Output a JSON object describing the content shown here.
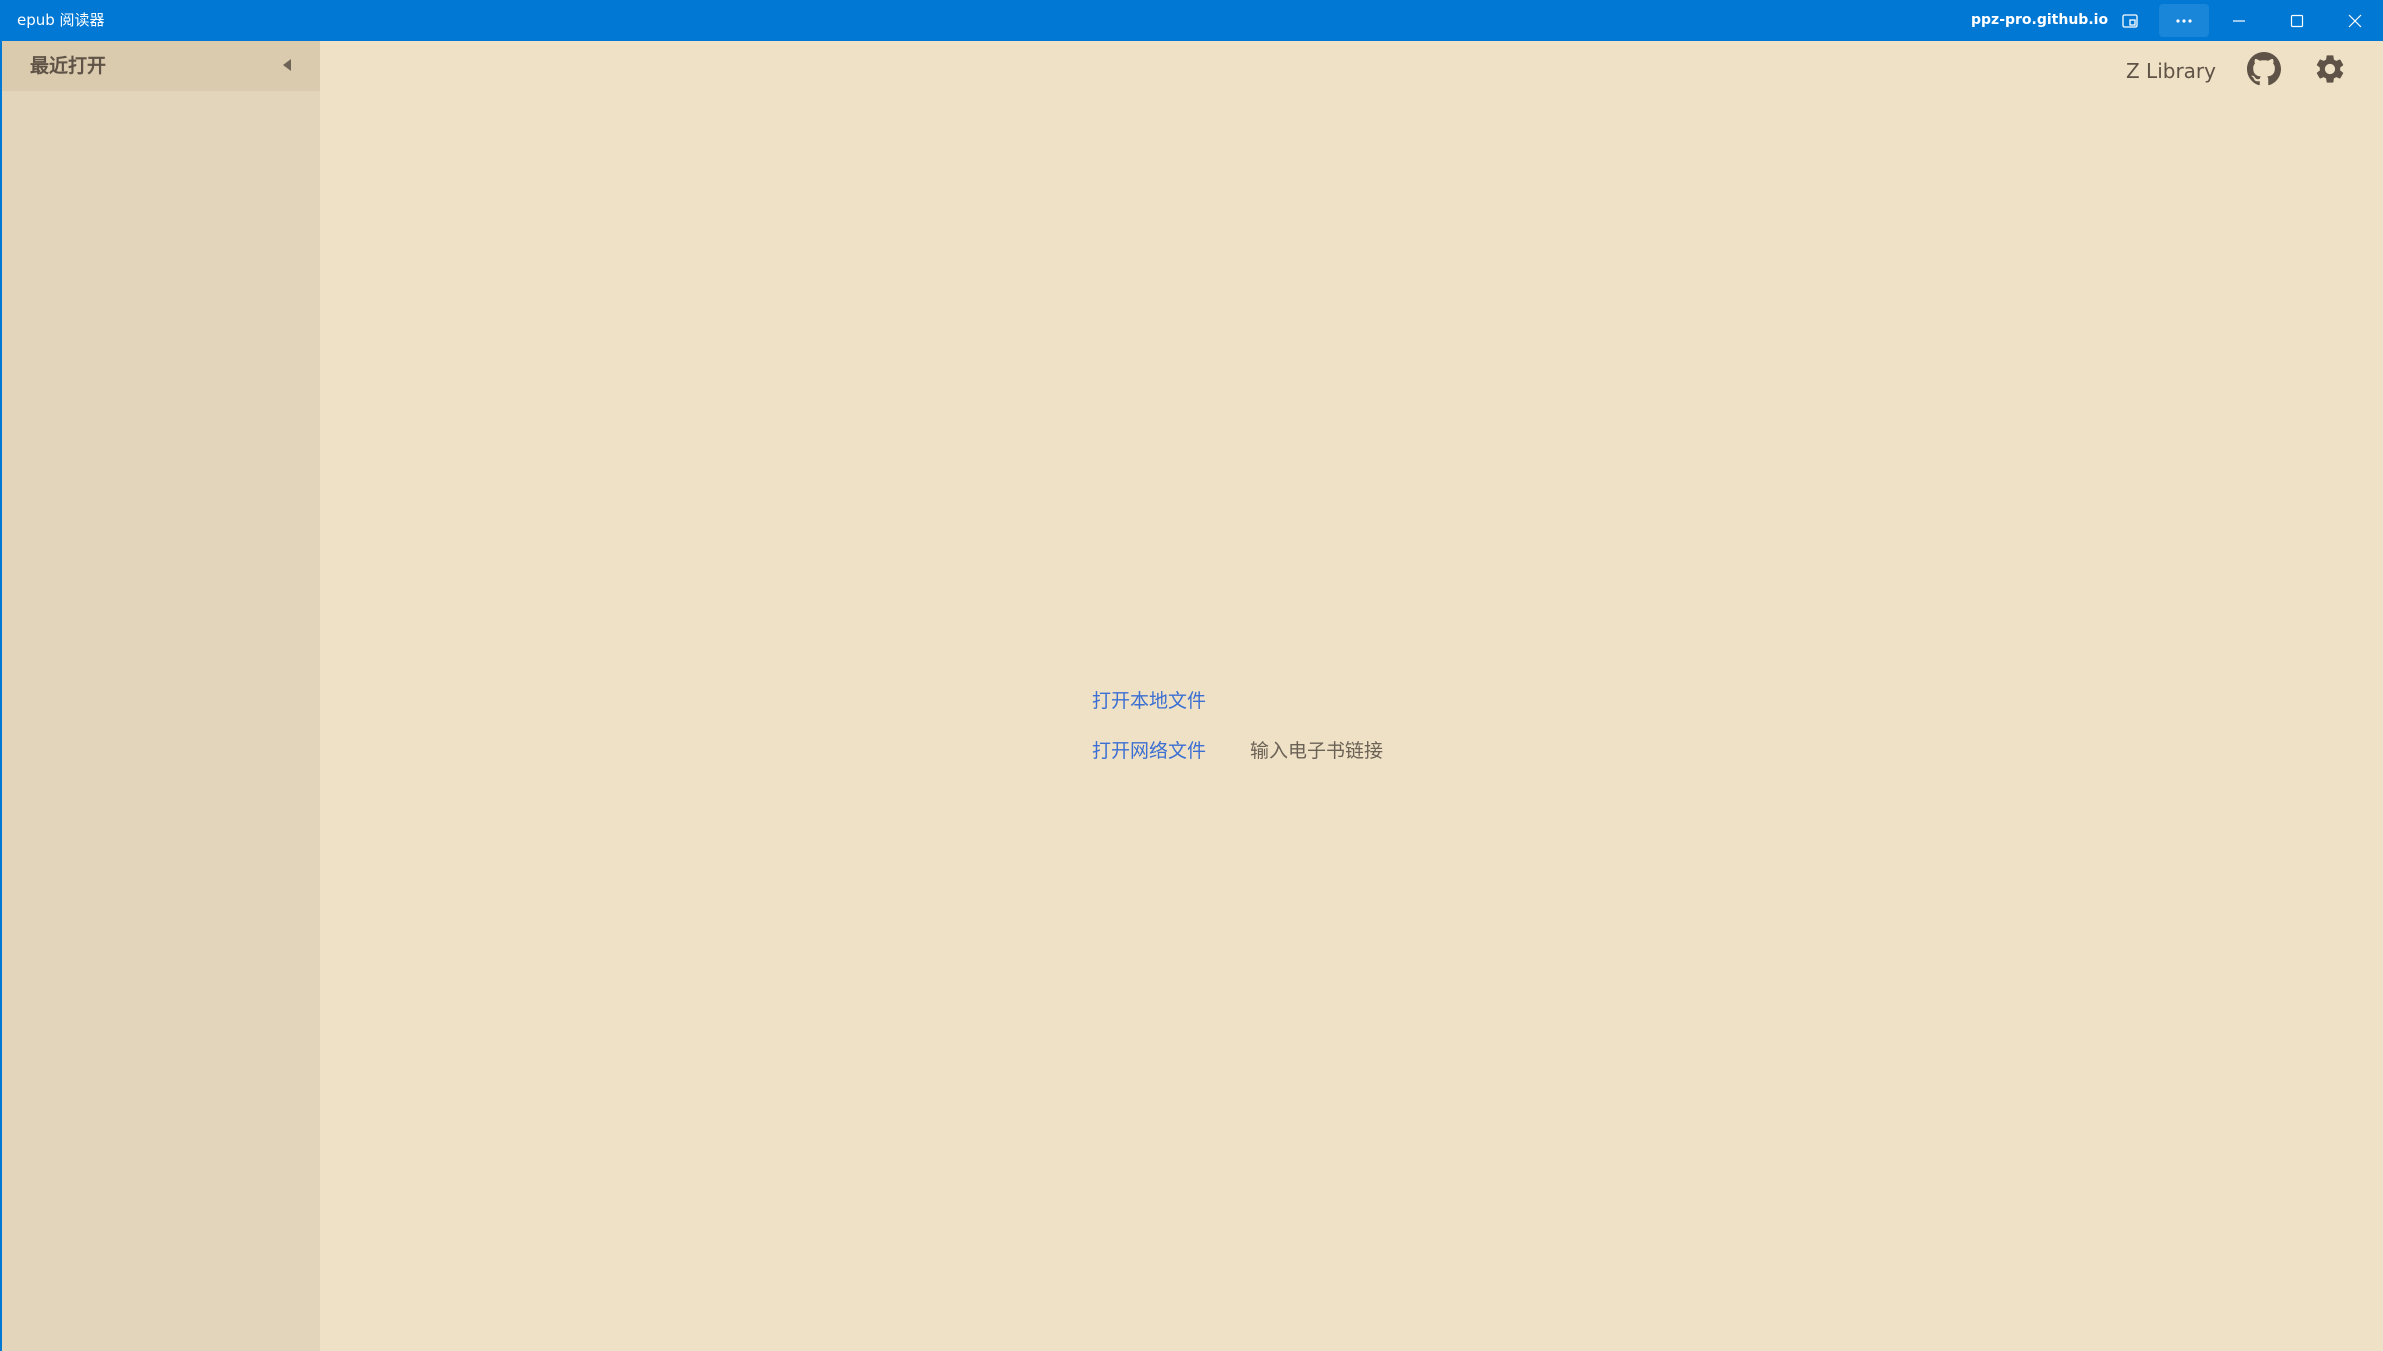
{
  "window": {
    "app_title": "epub 阅读器",
    "site": "ppz-pro.github.io",
    "accent_color": "#0078d4",
    "controls": [
      {
        "name": "cast-icon"
      },
      {
        "name": "more-icon"
      },
      {
        "name": "minimize-icon"
      },
      {
        "name": "maximize-icon"
      },
      {
        "name": "close-icon"
      }
    ]
  },
  "sidebar": {
    "title": "最近打开",
    "collapse_icon": "caret-left-icon",
    "items": []
  },
  "toolbar": {
    "zlibrary_label": "Z Library",
    "github_icon": "github-icon",
    "settings_icon": "gear-icon"
  },
  "main": {
    "open_local_label": "打开本地文件",
    "open_network_label": "打开网络文件",
    "url_input": {
      "value": "",
      "placeholder": "输入电子书链接"
    },
    "link_color": "#3b6fd3"
  },
  "theme": {
    "background": "#efe1c6",
    "sidebar_background": "#e3d5bb",
    "text_color": "#5e5346"
  }
}
